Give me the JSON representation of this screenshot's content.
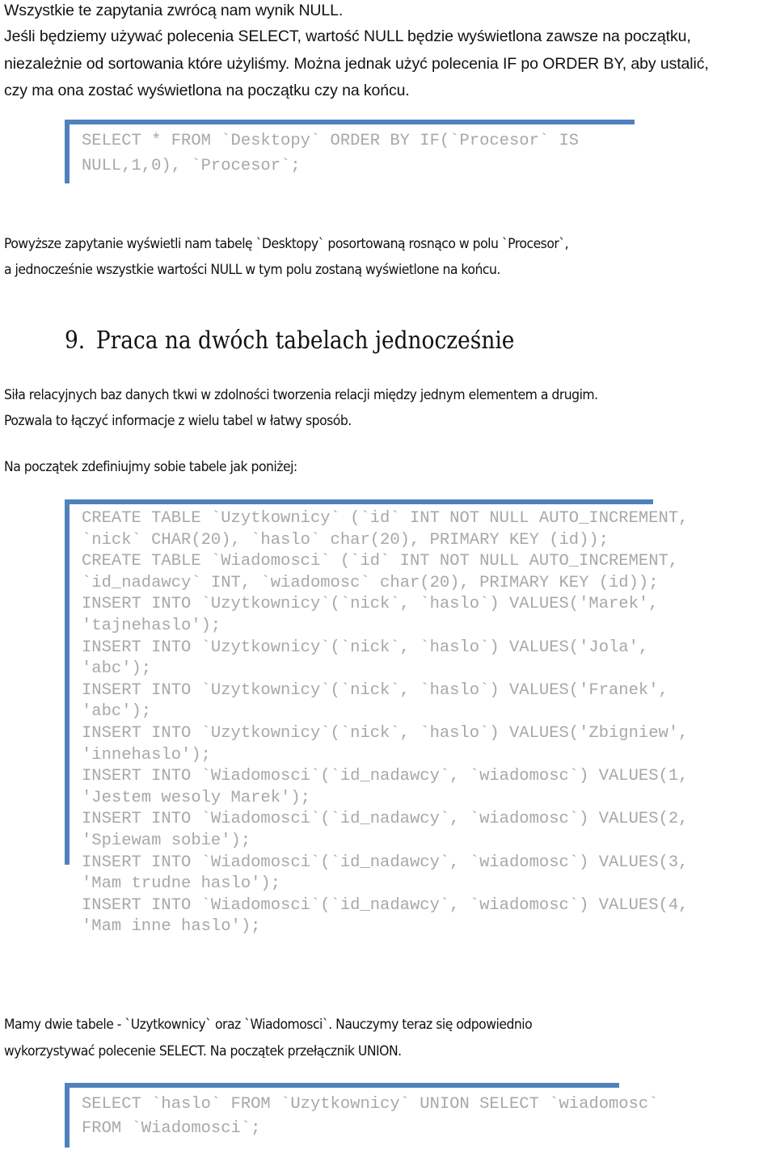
{
  "intro": {
    "lines": [
      "Wszystkie te zapytania zwrócą nam wynik NULL.",
      "Jeśli będziemy używać polecenia SELECT, wartość NULL będzie wyświetlona zawsze na początku,",
      "niezależnie od sortowania które użyliśmy. Można jednak użyć polecenia IF po ORDER BY, aby ustalić,",
      "czy ma ona zostać wyświetlona na początku czy na końcu."
    ]
  },
  "code_block_1": {
    "lines": [
      "SELECT * FROM `Desktopy` ORDER BY IF(`Procesor` IS",
      "NULL,1,0), `Procesor`;"
    ]
  },
  "explanation": {
    "lines": [
      "Powyższe zapytanie wyświetli nam tabelę `Desktopy` posortowaną rosnąco w polu `Procesor`,",
      "a jednocześnie wszystkie wartości NULL w tym polu zostaną wyświetlone na końcu."
    ]
  },
  "section": {
    "number": "9.",
    "title": "Praca na dwóch tabelach jednocześnie"
  },
  "section_intro": {
    "lines": [
      "Siła relacyjnych baz danych tkwi w zdolności tworzenia relacji między jednym elementem a drugim.",
      "Pozwala to łączyć informacje z wielu tabel w łatwy sposób."
    ],
    "define_line": "Na początek zdefiniujmy sobie tabele jak poniżej:"
  },
  "code_block_2": {
    "lines": [
      "CREATE TABLE `Uzytkownicy` (`id` INT NOT NULL AUTO_INCREMENT,",
      "`nick` CHAR(20), `haslo` char(20), PRIMARY KEY (id));",
      "CREATE TABLE `Wiadomosci` (`id` INT NOT NULL AUTO_INCREMENT,",
      "`id_nadawcy` INT, `wiadomosc` char(20), PRIMARY KEY (id));",
      "INSERT INTO `Uzytkownicy`(`nick`, `haslo`) VALUES('Marek',",
      "'tajnehaslo');",
      "INSERT INTO `Uzytkownicy`(`nick`, `haslo`) VALUES('Jola',",
      "'abc');",
      "INSERT INTO `Uzytkownicy`(`nick`, `haslo`) VALUES('Franek',",
      "'abc');",
      "INSERT INTO `Uzytkownicy`(`nick`, `haslo`) VALUES('Zbigniew',",
      "'innehaslo');",
      "INSERT INTO `Wiadomosci`(`id_nadawcy`, `wiadomosc`) VALUES(1,",
      "'Jestem wesoly Marek');",
      "INSERT INTO `Wiadomosci`(`id_nadawcy`, `wiadomosc`) VALUES(2,",
      "'Spiewam sobie');",
      "INSERT INTO `Wiadomosci`(`id_nadawcy`, `wiadomosc`) VALUES(3,",
      "'Mam trudne haslo');",
      "INSERT INTO `Wiadomosci`(`id_nadawcy`, `wiadomosc`) VALUES(4,",
      "'Mam inne haslo');"
    ]
  },
  "outro": {
    "lines": [
      "Mamy dwie tabele - `Uzytkownicy` oraz `Wiadomosci`. Nauczymy teraz się odpowiednio",
      "wykorzystywać polecenie SELECT. Na początek przełącznik UNION."
    ]
  },
  "code_block_3": {
    "lines": [
      "SELECT `haslo` FROM `Uzytkownicy` UNION SELECT `wiadomosc`",
      "FROM `Wiadomosci`;"
    ]
  },
  "colors": {
    "accent_border": "#4f81bd",
    "code_text": "#a8a8a8",
    "body_text": "#111111"
  }
}
